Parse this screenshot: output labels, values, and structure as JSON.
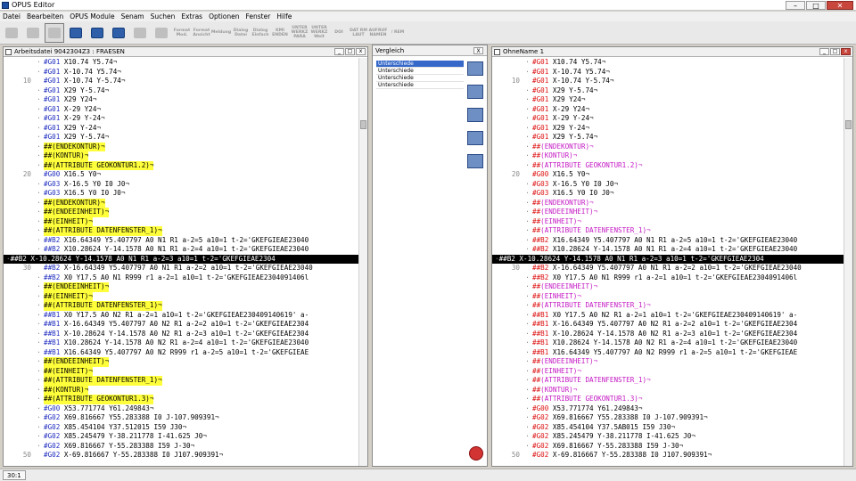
{
  "title": "OPUS Editor",
  "menu": [
    "Datei",
    "Bearbeiten",
    "OPUS Module",
    "Senam",
    "Suchen",
    "Extras",
    "Optionen",
    "Fenster",
    "Hilfe"
  ],
  "toolbar": [
    "Format Mod.",
    "Format Ansicht",
    "Meldung",
    "Dialog Datei",
    "Dialog Einfach",
    "KMI ENDEN",
    "UNTER WERKZ PARA",
    "UNTER WERKZ Weit",
    "DOI",
    "DAT RM LAUT",
    "AUFRUF NAMEN",
    "/ REM"
  ],
  "left_pane": {
    "title": "Arbeitsdatei  9042304Z3        : FRAESEN",
    "lines": [
      {
        "n": "",
        "t": "#G01 X10.74 Y5.74¬",
        "c": "g01"
      },
      {
        "n": "",
        "t": "#G01 X-10.74 Y5.74¬",
        "c": "g01"
      },
      {
        "n": "10",
        "t": "#G01 X-10.74 Y-5.74¬",
        "c": "g01"
      },
      {
        "n": "",
        "t": "#G01 X29 Y-5.74¬",
        "c": "g01"
      },
      {
        "n": "",
        "t": "#G01 X29 Y24¬",
        "c": "g01"
      },
      {
        "n": "",
        "t": "#G01 X-29 Y24¬",
        "c": "g01"
      },
      {
        "n": "",
        "t": "#G01 X-29 Y-24¬",
        "c": "g01"
      },
      {
        "n": "",
        "t": "#G01 X29 Y-24¬",
        "c": "g01"
      },
      {
        "n": "",
        "t": "#G01 X29 Y-5.74¬",
        "c": "g01"
      },
      {
        "n": "",
        "t": "##(ENDEKONTUR)¬",
        "c": "hl"
      },
      {
        "n": "",
        "t": "##(KONTUR)¬",
        "c": "hl"
      },
      {
        "n": "",
        "t": "##(ATTRIBUTE GEOKONTUR1.2)¬",
        "c": "hl"
      },
      {
        "n": "20",
        "t": "#G00 X16.5 Y0¬",
        "c": "g01"
      },
      {
        "n": "",
        "t": "#G03 X-16.5 Y0 I0 J0¬",
        "c": "g01"
      },
      {
        "n": "",
        "t": "#G03 X16.5 Y0 I0 J0¬",
        "c": "g01"
      },
      {
        "n": "",
        "t": "##(ENDEKONTUR)¬",
        "c": "hl"
      },
      {
        "n": "",
        "t": "##(ENDEEINHEIT)¬",
        "c": "hl"
      },
      {
        "n": "",
        "t": "##(EINHEIT)¬",
        "c": "hl"
      },
      {
        "n": "",
        "t": "##(ATTRIBUTE DATENFENSTER_1)¬",
        "c": "hl"
      },
      {
        "n": "",
        "t": "##B2 X16.64349 Y5.407797 A0 N1 R1 a-2=5 a10=1 t-2='GKEFGIEAE23040",
        "c": "b"
      },
      {
        "n": "",
        "t": "##B2 X10.28624 Y-14.1578 A0 N1 R1 a-2=4 a10=1 t-2='GKEFGIEAE23040",
        "c": "b"
      },
      {
        "n": "",
        "t": "##B2 X-10.28624 Y-14.1578 A0 N1 R1 a-2=3 a10=1 t-2='GKEFGIEAE2304",
        "c": "sel"
      },
      {
        "n": "30",
        "t": "##B2 X-16.64349 Y5.407797 A0 N1 R1 a-2=2 a10=1 t-2='GKEFGIEAE23040",
        "c": "b"
      },
      {
        "n": "",
        "t": "##B2 X0 Y17.5 A0 N1 R999 r1 a-2=1 a10=1 t-2='GKEFGIEAE2304091406l",
        "c": "b"
      },
      {
        "n": "",
        "t": "##(ENDEEINHEIT)¬",
        "c": "hl"
      },
      {
        "n": "",
        "t": "##(EINHEIT)¬",
        "c": "hl"
      },
      {
        "n": "",
        "t": "##(ATTRIBUTE DATENFENSTER_1)¬",
        "c": "hl"
      },
      {
        "n": "",
        "t": "##B1 X0 Y17.5 A0 N2 R1 a-2=1 a10=1 t-2='GKEFGIEAE230409140619' a-",
        "c": "b"
      },
      {
        "n": "",
        "t": "##B1 X-16.64349 Y5.407797 A0 N2 R1 a-2=2 a10=1 t-2='GKEFGIEAE2304",
        "c": "b"
      },
      {
        "n": "",
        "t": "##B1 X-10.28624 Y-14.1578 A0 N2 R1 a-2=3 a10=1 t-2='GKEFGIEAE2304",
        "c": "b"
      },
      {
        "n": "",
        "t": "##B1 X10.28624 Y-14.1578 A0 N2 R1 a-2=4 a10=1 t-2='GKEFGIEAE23040",
        "c": "b"
      },
      {
        "n": "",
        "t": "##B1 X16.64349 Y5.407797 A0 N2 R999 r1 a-2=5 a10=1 t-2='GKEFGIEAE",
        "c": "b"
      },
      {
        "n": "",
        "t": "##(ENDEEINHEIT)¬",
        "c": "hl"
      },
      {
        "n": "",
        "t": "##(EINHEIT)¬",
        "c": "hl"
      },
      {
        "n": "",
        "t": "##(ATTRIBUTE DATENFENSTER_1)¬",
        "c": "hl"
      },
      {
        "n": "",
        "t": "##(KONTUR)¬",
        "c": "hl"
      },
      {
        "n": "",
        "t": "##(ATTRIBUTE GEOKONTUR1.3)¬",
        "c": "hl"
      },
      {
        "n": "",
        "t": "#G00 X53.771774 Y61.249843¬",
        "c": "g01"
      },
      {
        "n": "",
        "t": "#G02 X69.816667 Y55.283388 I0 J-107.909391¬",
        "c": "g01"
      },
      {
        "n": "",
        "t": "#G02 X85.454104 Y37.512015 I59 J30¬",
        "c": "g01"
      },
      {
        "n": "",
        "t": "#G02 X85.245479 Y-38.211778 I-41.625 J0¬",
        "c": "g01"
      },
      {
        "n": "",
        "t": "#G02 X69.816667 Y-55.283388 I59 J-30¬",
        "c": "g01"
      },
      {
        "n": "50",
        "t": "#G02 X-69.816667 Y-55.283388 I0 J107.909391¬",
        "c": "g01"
      }
    ]
  },
  "right_pane": {
    "title": "OhneName 1",
    "lines": [
      {
        "n": "",
        "t": "#G01 X10.74 Y5.74¬"
      },
      {
        "n": "",
        "t": "#G01 X-10.74 Y5.74¬"
      },
      {
        "n": "10",
        "t": "#G01 X-10.74 Y-5.74¬"
      },
      {
        "n": "",
        "t": "#G01 X29 Y-5.74¬"
      },
      {
        "n": "",
        "t": "#G01 X29 Y24¬"
      },
      {
        "n": "",
        "t": "#G01 X-29 Y24¬"
      },
      {
        "n": "",
        "t": "#G01 X-29 Y-24¬"
      },
      {
        "n": "",
        "t": "#G01 X29 Y-24¬"
      },
      {
        "n": "",
        "t": "#G01 X29 Y-5.74¬"
      },
      {
        "n": "",
        "t": "##(ENDEKONTUR)¬"
      },
      {
        "n": "",
        "t": "##(KONTUR)¬"
      },
      {
        "n": "",
        "t": "##(ATTRIBUTE GEOKONTUR1.2)¬"
      },
      {
        "n": "20",
        "t": "#G00 X16.5 Y0¬"
      },
      {
        "n": "",
        "t": "#G03 X-16.5 Y0 I0 J0¬"
      },
      {
        "n": "",
        "t": "#G03 X16.5 Y0 I0 J0¬"
      },
      {
        "n": "",
        "t": "##(ENDEKONTUR)¬"
      },
      {
        "n": "",
        "t": "##(ENDEEINHEIT)¬"
      },
      {
        "n": "",
        "t": "##(EINHEIT)¬"
      },
      {
        "n": "",
        "t": "##(ATTRIBUTE DATENFENSTER_1)¬"
      },
      {
        "n": "",
        "t": "##B2 X16.64349 Y5.407797 A0 N1 R1 a-2=5 a10=1 t-2='GKEFGIEAE23040"
      },
      {
        "n": "",
        "t": "##B2 X10.28624 Y-14.1578 A0 N1 R1 a-2=4 a10=1 t-2='GKEFGIEAE23040"
      },
      {
        "n": "",
        "t": "##B2 X-10.28624 Y-14.1578 A0 N1 R1 a-2=3 a10=1 t-2='GKEFGIEAE2304",
        "sel": true
      },
      {
        "n": "30",
        "t": "##B2 X-16.64349 Y5.407797 A0 N1 R1 a-2=2 a10=1 t-2='GKEFGIEAE23040"
      },
      {
        "n": "",
        "t": "##B2 X0 Y17.5 A0 N1 R999 r1 a-2=1 a10=1 t-2='GKEFGIEAE2304091406l"
      },
      {
        "n": "",
        "t": "##(ENDEEINHEIT)¬"
      },
      {
        "n": "",
        "t": "##(EINHEIT)¬"
      },
      {
        "n": "",
        "t": "##(ATTRIBUTE DATENFENSTER_1)¬"
      },
      {
        "n": "",
        "t": "##B1 X0 Y17.5 A0 N2 R1 a-2=1 a10=1 t-2='GKEFGIEAE230409140619' a-"
      },
      {
        "n": "",
        "t": "##B1 X-16.64349 Y5.407797 A0 N2 R1 a-2=2 a10=1 t-2='GKEFGIEAE2304"
      },
      {
        "n": "",
        "t": "##B1 X-10.28624 Y-14.1578 A0 N2 R1 a-2=3 a10=1 t-2='GKEFGIEAE2304"
      },
      {
        "n": "",
        "t": "##B1 X10.28624 Y-14.1578 A0 N2 R1 a-2=4 a10=1 t-2='GKEFGIEAE23040"
      },
      {
        "n": "",
        "t": "##B1 X16.64349 Y5.407797 A0 N2 R999 r1 a-2=5 a10=1 t-2='GKEFGIEAE"
      },
      {
        "n": "",
        "t": "##(ENDEEINHEIT)¬"
      },
      {
        "n": "",
        "t": "##(EINHEIT)¬"
      },
      {
        "n": "",
        "t": "##(ATTRIBUTE DATENFENSTER_1)¬"
      },
      {
        "n": "",
        "t": "##(KONTUR)¬"
      },
      {
        "n": "",
        "t": "##(ATTRIBUTE GEOKONTUR1.3)¬"
      },
      {
        "n": "",
        "t": "#G00 X53.771774 Y61.249843¬"
      },
      {
        "n": "",
        "t": "#G02 X69.816667 Y55.283388 I0 J-107.909391¬"
      },
      {
        "n": "",
        "t": "#G02 X85.454104 Y37.5AB015 I59 J30¬"
      },
      {
        "n": "",
        "t": "#G02 X85.245479 Y-38.211778 I-41.625 J0¬"
      },
      {
        "n": "",
        "t": "#G02 X69.816667 Y-55.283388 I59 J-30¬"
      },
      {
        "n": "50",
        "t": "#G02 X-69.816667 Y-55.283388 I0 J107.909391¬"
      }
    ]
  },
  "compare": {
    "title": "Vergleich",
    "close": "X",
    "items": [
      "Unterschiede",
      "Unterschiede",
      "Unterschiede",
      "Unterschiede"
    ],
    "selected_index": 0
  },
  "status": {
    "position": "30:1"
  },
  "colors": {
    "highlight": "#ffff3b",
    "code_red": "#d11111",
    "code_blue": "#2230c0",
    "code_magenta": "#c418c4"
  }
}
